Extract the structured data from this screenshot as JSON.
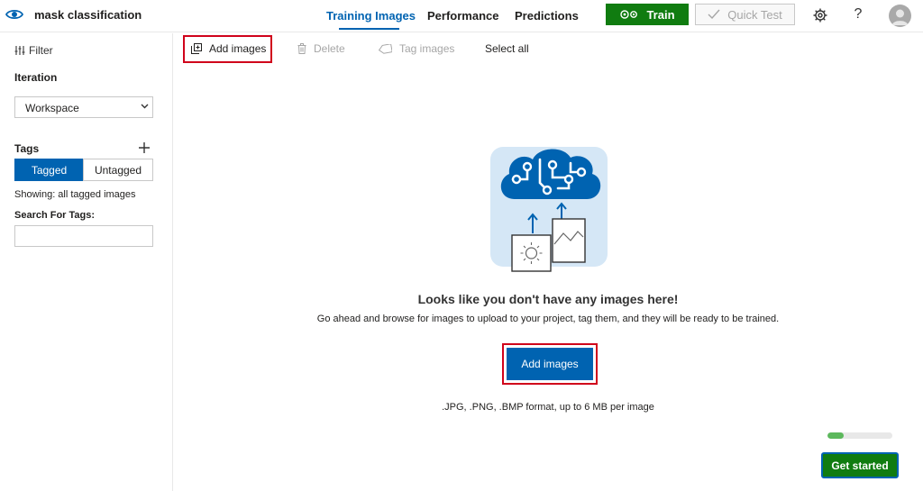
{
  "header": {
    "project_name": "mask classification",
    "tabs": [
      {
        "label": "Training Images",
        "active": true
      },
      {
        "label": "Performance",
        "active": false
      },
      {
        "label": "Predictions",
        "active": false
      }
    ],
    "train_label": "Train",
    "quick_test_label": "Quick Test",
    "help_label": "?"
  },
  "sidebar": {
    "filter_label": "Filter",
    "iteration_heading": "Iteration",
    "iteration_value": "Workspace",
    "tags_heading": "Tags",
    "segments": {
      "tagged": "Tagged",
      "untagged": "Untagged"
    },
    "showing_text": "Showing: all tagged images",
    "search_label": "Search For Tags:",
    "search_value": ""
  },
  "toolbar": {
    "add_images": "Add images",
    "delete": "Delete",
    "tag_images": "Tag images",
    "select_all": "Select all"
  },
  "main": {
    "empty_title": "Looks like you don't have any images here!",
    "empty_description": "Go ahead and browse for images to upload to your project, tag them, and they will be ready to be trained.",
    "add_images_button": "Add images",
    "formats_note": ".JPG, .PNG, .BMP format, up to 6 MB per image"
  },
  "onboarding": {
    "progress_fraction": 0.25,
    "get_started_label": "Get started"
  },
  "colors": {
    "accent_blue": "#0063b1",
    "train_green": "#107c10",
    "highlight_red": "#d0021b",
    "progress_green": "#5cb85c"
  },
  "icons": [
    "eye-icon",
    "gears-icon",
    "checkmark-icon",
    "settings-gear-icon",
    "avatar-icon",
    "filter-icon",
    "chevron-down-icon",
    "plus-icon",
    "add-images-icon",
    "trash-icon",
    "tag-icon",
    "cloud-circuit-icon",
    "image-upload-icon"
  ]
}
